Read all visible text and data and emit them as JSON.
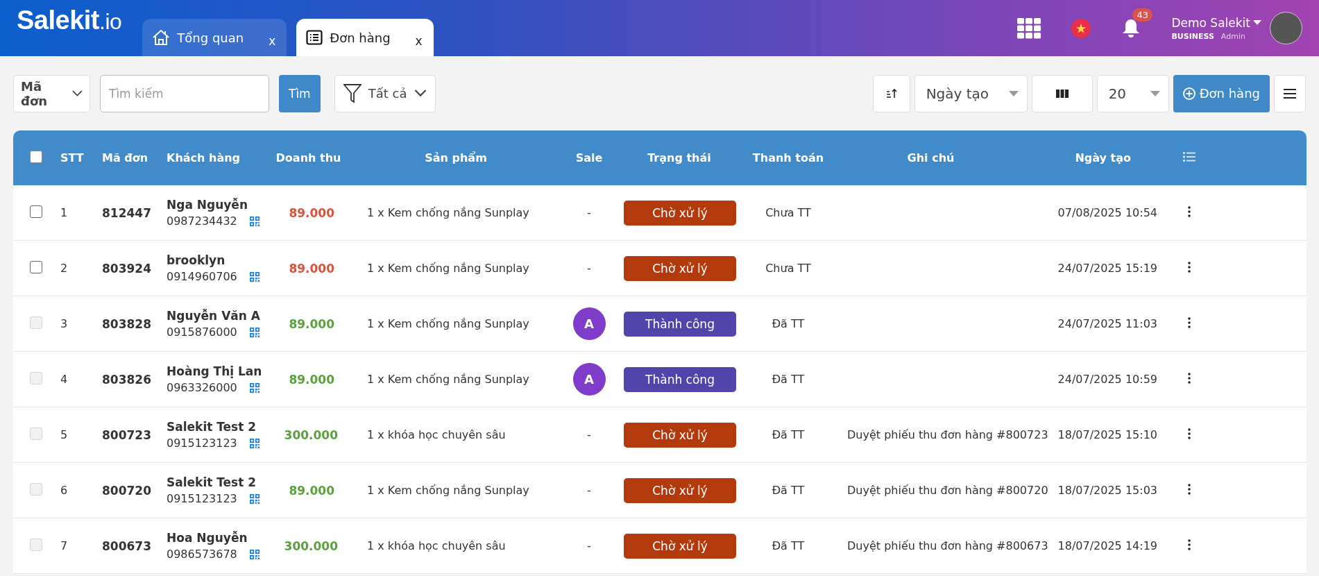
{
  "header": {
    "logo": {
      "brand": "Salekit",
      "suffix": ".io"
    },
    "tabs": [
      {
        "kind": "home",
        "label": "Tổng quan",
        "close": "x",
        "selected": false
      },
      {
        "kind": "list",
        "label": "Đơn hàng",
        "close": "x",
        "selected": true
      }
    ],
    "notifications": {
      "count": "43"
    },
    "user": {
      "name": "Demo Salekit",
      "plan": "BUSINESS",
      "role": "Admin"
    }
  },
  "toolbar": {
    "search_by": "Mã đơn",
    "search": {
      "placeholder": "Tìm kiếm"
    },
    "search_button": "Tìm",
    "filter": "Tất cả",
    "sort_field": "Ngày tạo",
    "page_size": "20",
    "add_button": "Đơn hàng"
  },
  "table": {
    "select_all": {
      "checked": false
    },
    "columns": [
      "STT",
      "Mã đơn",
      "Khách hàng",
      "Doanh thu",
      "Sản phẩm",
      "Sale",
      "Trạng thái",
      "Thanh toán",
      "Ghi chú",
      "Ngày tạo"
    ],
    "rows": [
      {
        "checked": false,
        "disabled": false,
        "stt": "1",
        "code": "812447",
        "customer": "Nga Nguyễn",
        "phone": "0987234432",
        "revenue": "89.000",
        "paid": false,
        "product": "1 x Kem chống nắng Sunplay",
        "sale": {
          "kind": "text",
          "text": "-"
        },
        "status": {
          "kind": "pending",
          "label": "Chờ xử lý"
        },
        "payment": "Chưa TT",
        "created": "07/08/2025 10:54"
      },
      {
        "checked": false,
        "disabled": false,
        "stt": "2",
        "code": "803924",
        "customer": "brooklyn",
        "phone": "0914960706",
        "revenue": "89.000",
        "paid": false,
        "product": "1 x Kem chống nắng Sunplay",
        "sale": {
          "kind": "text",
          "text": "-"
        },
        "status": {
          "kind": "pending",
          "label": "Chờ xử lý"
        },
        "payment": "Chưa TT",
        "created": "24/07/2025 15:19"
      },
      {
        "checked": false,
        "disabled": true,
        "stt": "3",
        "code": "803828",
        "customer": "Nguyễn Văn A",
        "phone": "0915876000",
        "revenue": "89.000",
        "paid": true,
        "product": "1 x Kem chống nắng Sunplay",
        "sale": {
          "kind": "avatar",
          "text": "A"
        },
        "status": {
          "kind": "success",
          "label": "Thành công"
        },
        "payment": "Đã TT",
        "created": "24/07/2025 11:03"
      },
      {
        "checked": false,
        "disabled": true,
        "stt": "4",
        "code": "803826",
        "customer": "Hoàng Thị Lan",
        "phone": "0963326000",
        "revenue": "89.000",
        "paid": true,
        "product": "1 x Kem chống nắng Sunplay",
        "sale": {
          "kind": "avatar",
          "text": "A"
        },
        "status": {
          "kind": "success",
          "label": "Thành công"
        },
        "payment": "Đã TT",
        "created": "24/07/2025 10:59"
      },
      {
        "checked": false,
        "disabled": true,
        "stt": "5",
        "code": "800723",
        "customer": "Salekit Test 2",
        "phone": "0915123123",
        "revenue": "300.000",
        "paid": true,
        "product": "1 x khóa học chuyên sâu",
        "sale": {
          "kind": "text",
          "text": "-"
        },
        "status": {
          "kind": "pending",
          "label": "Chờ xử lý"
        },
        "payment": "Đã TT",
        "note": "Duyệt phiếu thu đơn hàng #800723",
        "created": "18/07/2025 15:10"
      },
      {
        "checked": false,
        "disabled": true,
        "stt": "6",
        "code": "800720",
        "customer": "Salekit Test 2",
        "phone": "0915123123",
        "revenue": "89.000",
        "paid": true,
        "product": "1 x Kem chống nắng Sunplay",
        "sale": {
          "kind": "text",
          "text": "-"
        },
        "status": {
          "kind": "pending",
          "label": "Chờ xử lý"
        },
        "payment": "Đã TT",
        "note": "Duyệt phiếu thu đơn hàng #800720",
        "created": "18/07/2025 15:03"
      },
      {
        "checked": false,
        "disabled": true,
        "stt": "7",
        "code": "800673",
        "customer": "Hoa Nguyễn",
        "phone": "0986573678",
        "revenue": "300.000",
        "paid": true,
        "product": "1 x khóa học chuyên sâu",
        "sale": {
          "kind": "text",
          "text": "-"
        },
        "status": {
          "kind": "pending",
          "label": "Chờ xử lý"
        },
        "payment": "Đã TT",
        "note": "Duyệt phiếu thu đơn hàng #800673",
        "created": "18/07/2025 14:19"
      }
    ]
  }
}
